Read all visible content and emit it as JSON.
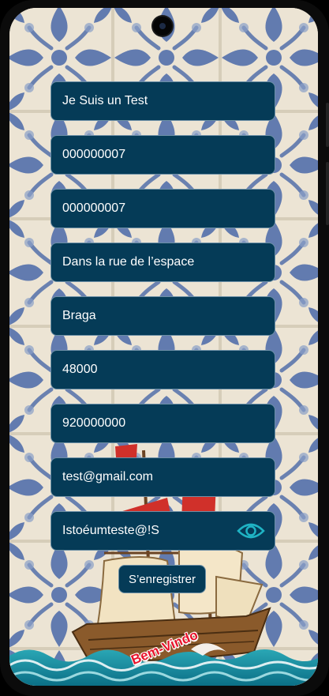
{
  "form": {
    "fields": [
      {
        "name": "name-field",
        "value": "Je Suis un Test"
      },
      {
        "name": "id-field",
        "value": "000000007"
      },
      {
        "name": "id-confirm-field",
        "value": "000000007"
      },
      {
        "name": "address-field",
        "value": "Dans la rue de l’espace"
      },
      {
        "name": "city-field",
        "value": "Braga"
      },
      {
        "name": "postal-code-field",
        "value": "48000"
      },
      {
        "name": "phone-field",
        "value": "920000000"
      },
      {
        "name": "email-field",
        "value": "test@gmail.com"
      },
      {
        "name": "password-field",
        "value": "Istoéumteste@!S"
      }
    ],
    "password_toggle_icon": "eye-icon",
    "submit_label": "S’enregistrer"
  },
  "background": {
    "welcome_text": "Bem-Vindo",
    "illustration": "sailing-ship-on-azulejo-tiles"
  },
  "colors": {
    "field_bg": "#053b57",
    "field_border": "#6c8fa6",
    "text": "#ffffff",
    "eye_icon": "#1fb3c4",
    "tile_blue": "#4a68a8",
    "tile_bg": "#ece4d4",
    "welcome_red": "#e8132b"
  }
}
